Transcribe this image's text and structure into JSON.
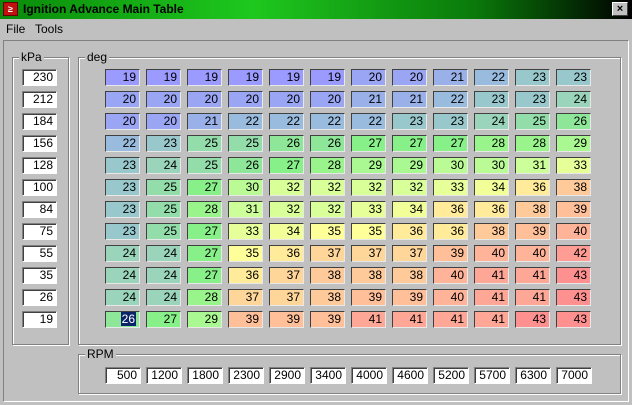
{
  "window": {
    "title": "Ignition Advance Main Table",
    "icon": "app-icon",
    "close": "×"
  },
  "menu": [
    "File",
    "Tools"
  ],
  "kpa": {
    "label": "kPa",
    "values": [
      "230",
      "212",
      "184",
      "156",
      "128",
      "100",
      "84",
      "75",
      "55",
      "35",
      "26",
      "19"
    ]
  },
  "deg": {
    "label": "deg",
    "selected": [
      11,
      0
    ],
    "rows": [
      [
        19,
        19,
        19,
        19,
        19,
        19,
        20,
        20,
        21,
        22,
        23,
        23
      ],
      [
        20,
        20,
        20,
        20,
        20,
        20,
        21,
        21,
        22,
        23,
        23,
        24
      ],
      [
        20,
        20,
        21,
        22,
        22,
        22,
        22,
        23,
        23,
        24,
        25,
        26
      ],
      [
        22,
        23,
        25,
        25,
        26,
        26,
        27,
        27,
        27,
        28,
        28,
        29
      ],
      [
        23,
        24,
        25,
        26,
        27,
        28,
        29,
        29,
        30,
        30,
        31,
        33
      ],
      [
        23,
        25,
        27,
        30,
        32,
        32,
        32,
        32,
        33,
        34,
        36,
        38
      ],
      [
        23,
        25,
        28,
        31,
        32,
        32,
        33,
        34,
        36,
        36,
        38,
        39
      ],
      [
        23,
        25,
        27,
        33,
        34,
        35,
        35,
        36,
        36,
        38,
        39,
        40
      ],
      [
        24,
        24,
        27,
        35,
        36,
        37,
        37,
        37,
        39,
        40,
        40,
        42
      ],
      [
        24,
        24,
        27,
        36,
        37,
        38,
        38,
        38,
        40,
        41,
        41,
        43
      ],
      [
        24,
        24,
        28,
        37,
        37,
        38,
        39,
        39,
        40,
        41,
        41,
        43
      ],
      [
        26,
        27,
        29,
        39,
        39,
        39,
        41,
        41,
        41,
        41,
        43,
        43
      ]
    ]
  },
  "rpm": {
    "label": "RPM",
    "values": [
      "500",
      "1200",
      "1800",
      "2300",
      "2900",
      "3400",
      "4000",
      "4600",
      "5200",
      "5700",
      "6300",
      "7000"
    ]
  },
  "colors": {
    "stops": [
      [
        19,
        "#9a9aff"
      ],
      [
        22,
        "#99bbdd"
      ],
      [
        24,
        "#99d4bb"
      ],
      [
        27,
        "#88f088"
      ],
      [
        31,
        "#ccff99"
      ],
      [
        35,
        "#ffff99"
      ],
      [
        37,
        "#ffd699"
      ],
      [
        40,
        "#ffb399"
      ],
      [
        43,
        "#ff9090"
      ]
    ]
  }
}
